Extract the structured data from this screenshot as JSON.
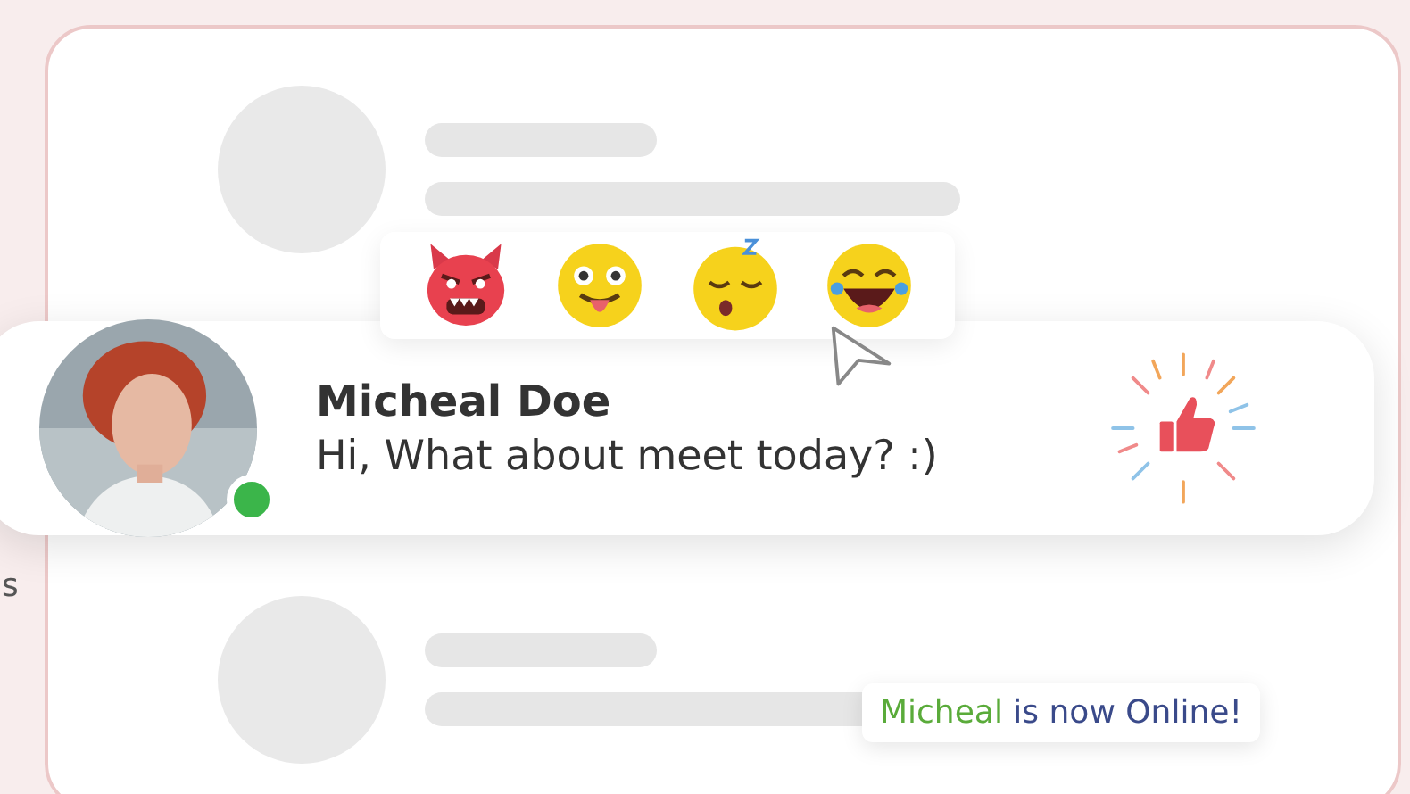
{
  "edge_text": "s",
  "reactions": [
    {
      "kind": "devil"
    },
    {
      "kind": "tongue"
    },
    {
      "kind": "sleepy"
    },
    {
      "kind": "laughing"
    }
  ],
  "message": {
    "sender": "Micheal Doe",
    "text": "Hi, What about meet today? :)",
    "online": true
  },
  "toast": {
    "name": "Micheal",
    "text": "is now Online!"
  }
}
